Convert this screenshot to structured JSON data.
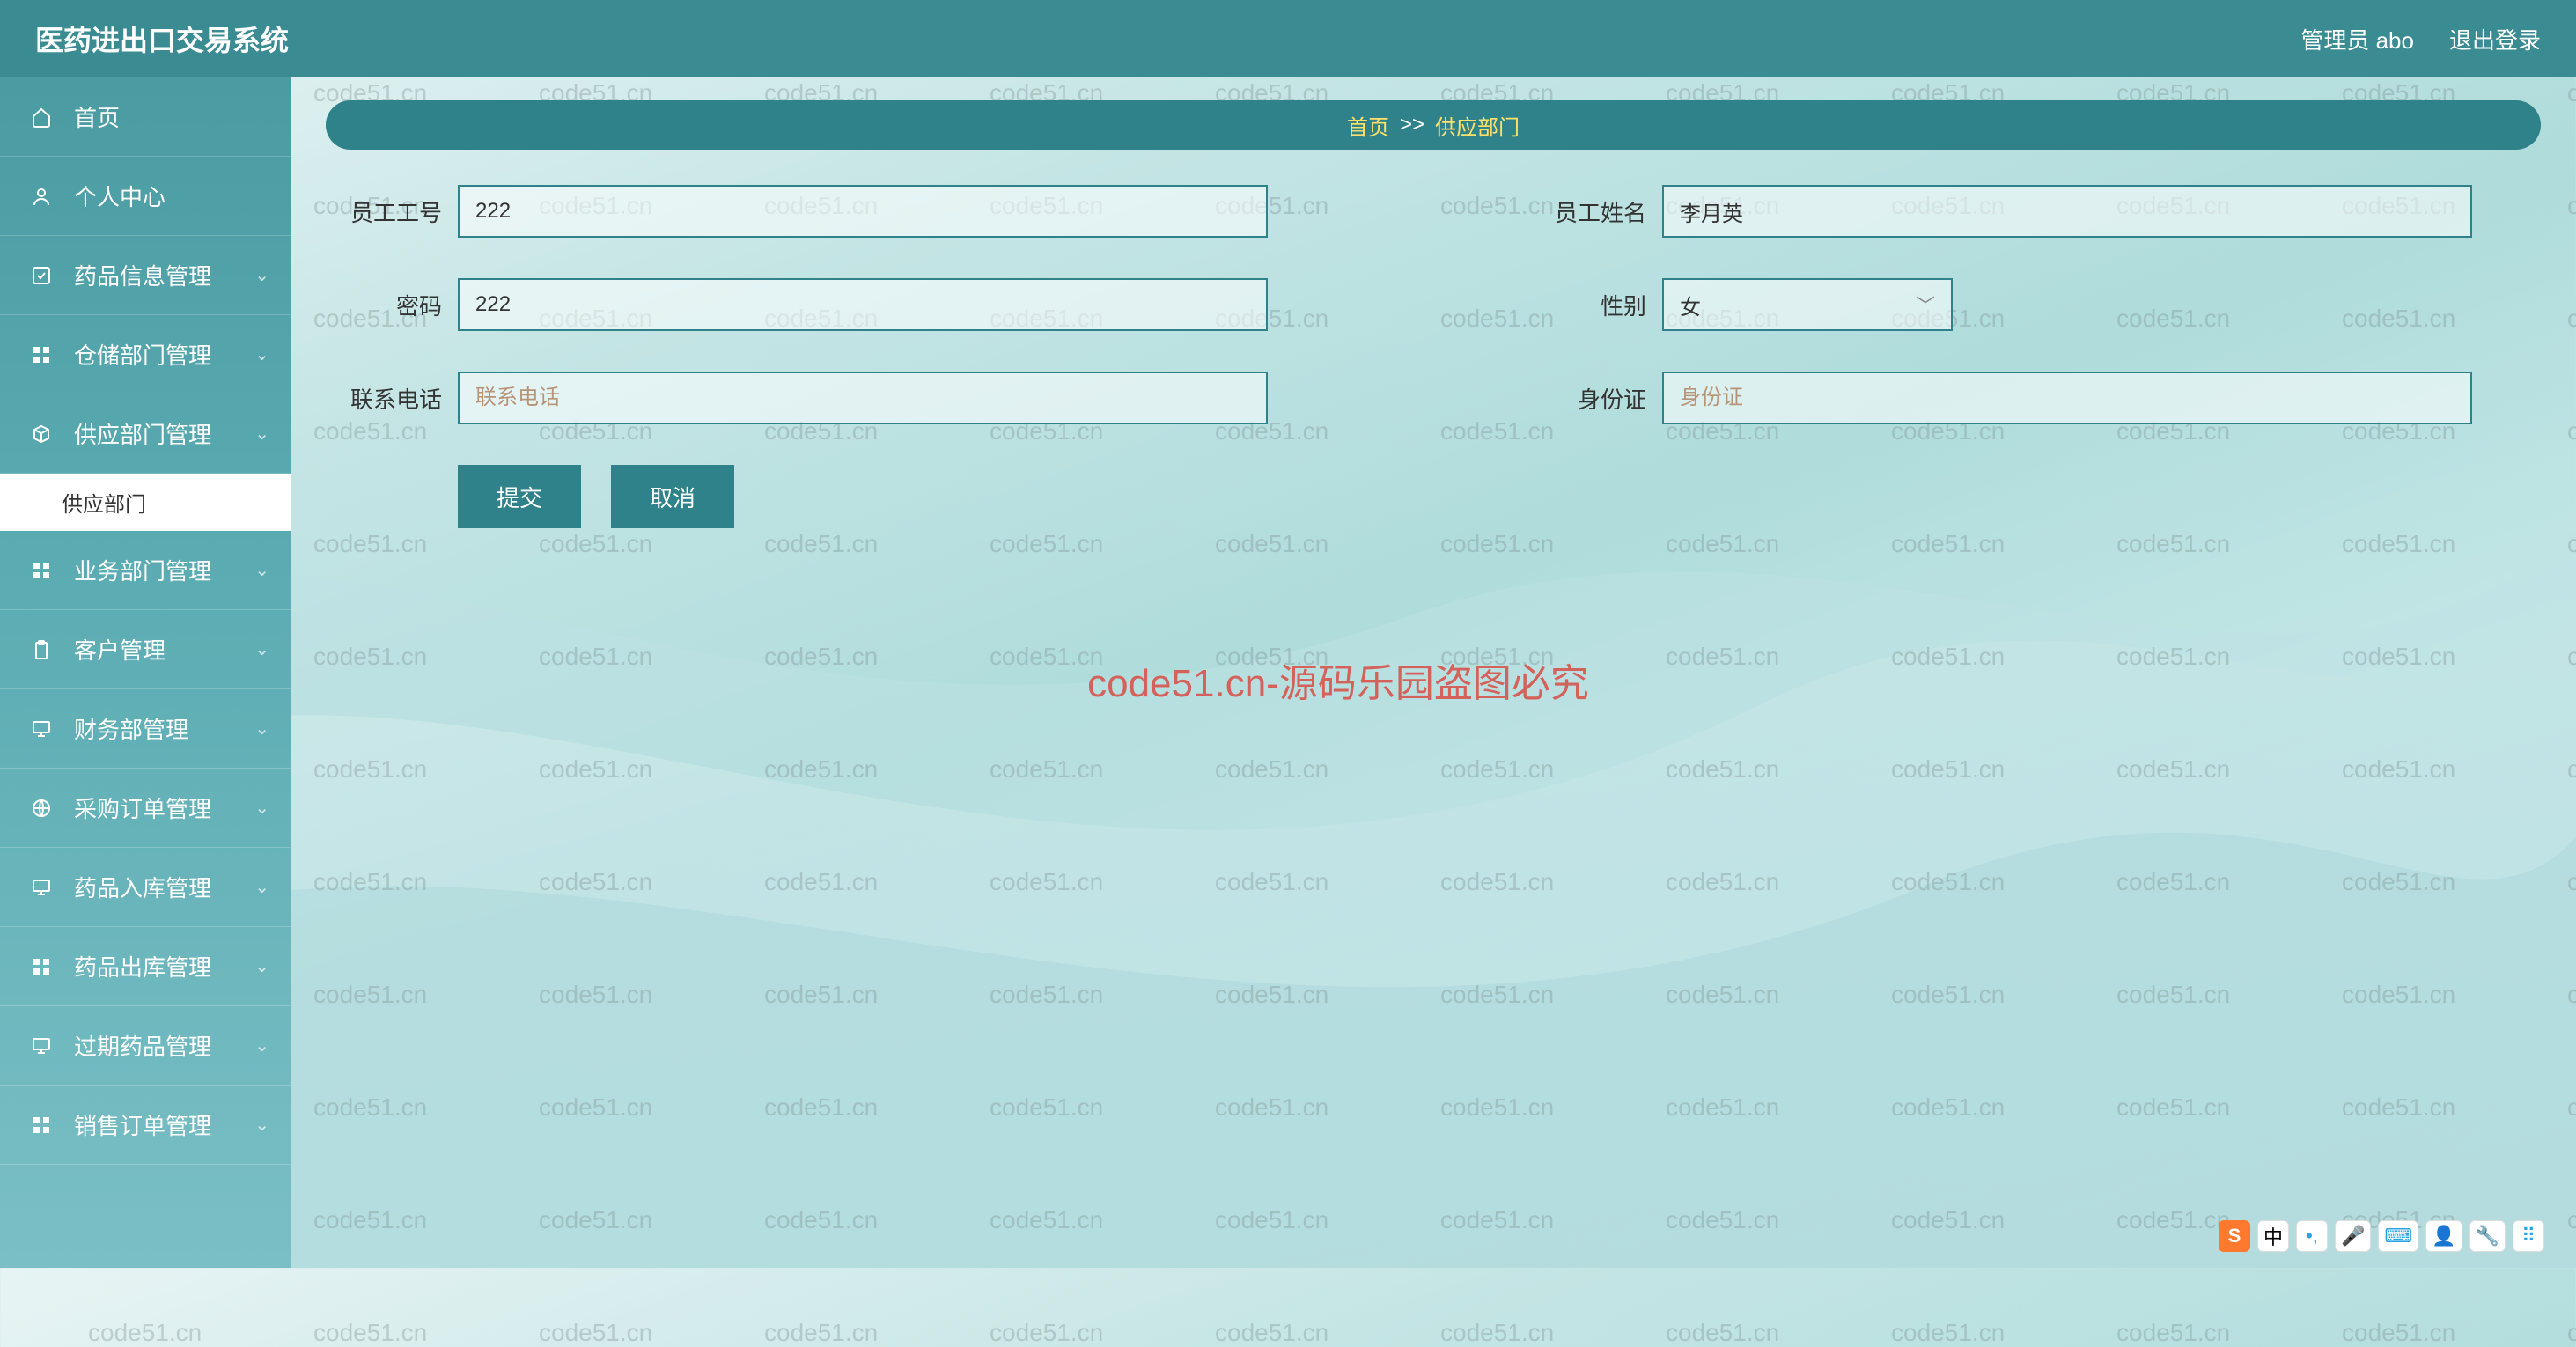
{
  "header": {
    "title": "医药进出口交易系统",
    "admin_label": "管理员 abo",
    "logout_label": "退出登录"
  },
  "sidebar": {
    "items": [
      {
        "icon": "home",
        "label": "首页",
        "expandable": false
      },
      {
        "icon": "user",
        "label": "个人中心",
        "expandable": false
      },
      {
        "icon": "check",
        "label": "药品信息管理",
        "expandable": true
      },
      {
        "icon": "grid",
        "label": "仓储部门管理",
        "expandable": true
      },
      {
        "icon": "box",
        "label": "供应部门管理",
        "expandable": true
      },
      {
        "icon": "grid",
        "label": "业务部门管理",
        "expandable": true
      },
      {
        "icon": "clipboard",
        "label": "客户管理",
        "expandable": true
      },
      {
        "icon": "monitor",
        "label": "财务部管理",
        "expandable": true
      },
      {
        "icon": "globe",
        "label": "采购订单管理",
        "expandable": true
      },
      {
        "icon": "monitor",
        "label": "药品入库管理",
        "expandable": true
      },
      {
        "icon": "grid",
        "label": "药品出库管理",
        "expandable": true
      },
      {
        "icon": "monitor",
        "label": "过期药品管理",
        "expandable": true
      },
      {
        "icon": "grid",
        "label": "销售订单管理",
        "expandable": true
      }
    ],
    "active_sub": "供应部门"
  },
  "breadcrumb": {
    "root": "首页",
    "sep": ">>",
    "current": "供应部门"
  },
  "form": {
    "employee_id": {
      "label": "员工工号",
      "value": "222"
    },
    "employee_name": {
      "label": "员工姓名",
      "value": "李月英"
    },
    "password": {
      "label": "密码",
      "value": "222"
    },
    "gender": {
      "label": "性别",
      "value": "女"
    },
    "phone": {
      "label": "联系电话",
      "placeholder": "联系电话",
      "value": ""
    },
    "id_card": {
      "label": "身份证",
      "placeholder": "身份证",
      "value": ""
    },
    "submit_label": "提交",
    "cancel_label": "取消"
  },
  "watermark": {
    "text": "code51.cn",
    "center": "code51.cn-源码乐园盗图必究"
  },
  "ime": {
    "logo": "S",
    "lang": "中"
  }
}
